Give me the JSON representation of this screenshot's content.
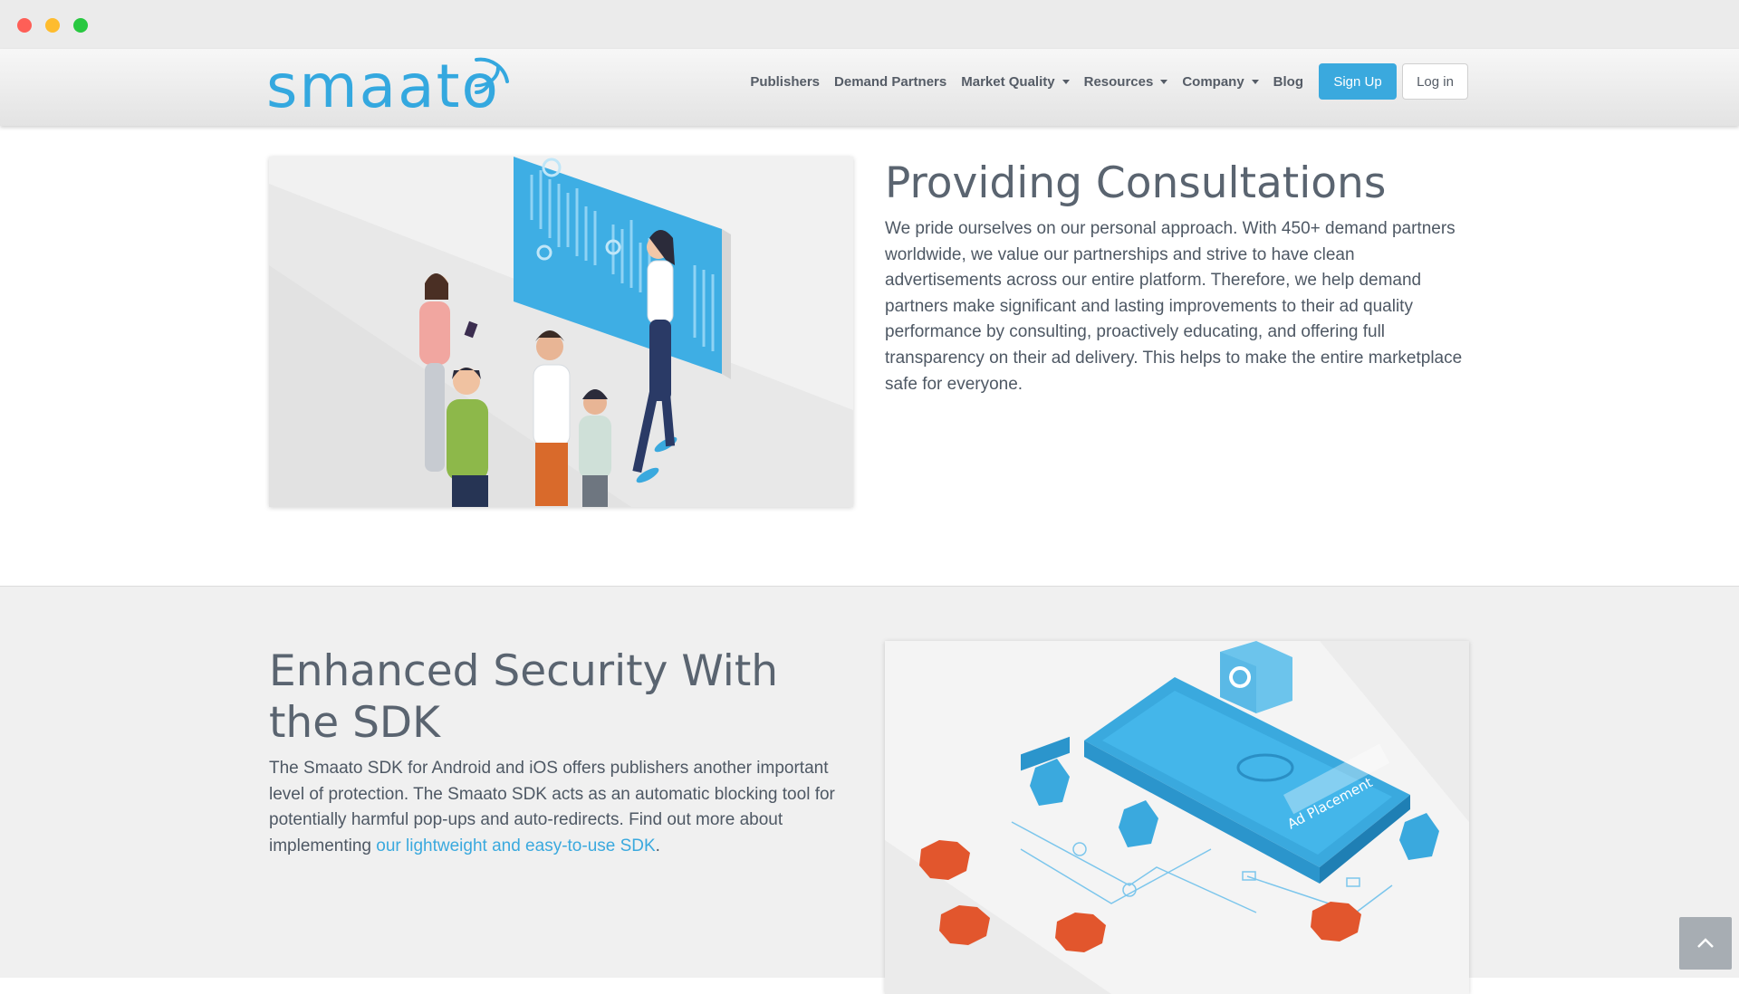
{
  "brand": {
    "name": "smaato",
    "color": "#34a8df"
  },
  "nav": {
    "items": [
      {
        "label": "Publishers",
        "dropdown": false
      },
      {
        "label": "Demand Partners",
        "dropdown": false
      },
      {
        "label": "Market Quality",
        "dropdown": true
      },
      {
        "label": "Resources",
        "dropdown": true
      },
      {
        "label": "Company",
        "dropdown": true
      },
      {
        "label": "Blog",
        "dropdown": false
      }
    ],
    "signup_label": "Sign Up",
    "login_label": "Log in"
  },
  "section_consultations": {
    "title": "Providing Consultations",
    "body": "We pride ourselves on our personal approach. With 450+ demand partners worldwide, we value our partnerships and strive to have clean advertisements across our entire platform. Therefore, we help demand partners make significant and lasting improvements to their ad quality performance by consulting, proactively educating, and offering full transparency on their ad delivery. This helps to make the entire marketplace safe for everyone."
  },
  "section_security": {
    "title": "Enhanced Security With the SDK",
    "body_prefix": "The Smaato SDK for Android and iOS offers publishers another important level of protection. The Smaato SDK acts as an automatic blocking tool for potentially harmful pop-ups and auto-redirects. Find out more about implementing ",
    "link_label": "our lightweight and easy-to-use SDK",
    "body_suffix": ".",
    "illustration_label": "Ad Placement"
  },
  "icons": [
    "smaato-signal-icon",
    "chevron-up-icon"
  ]
}
